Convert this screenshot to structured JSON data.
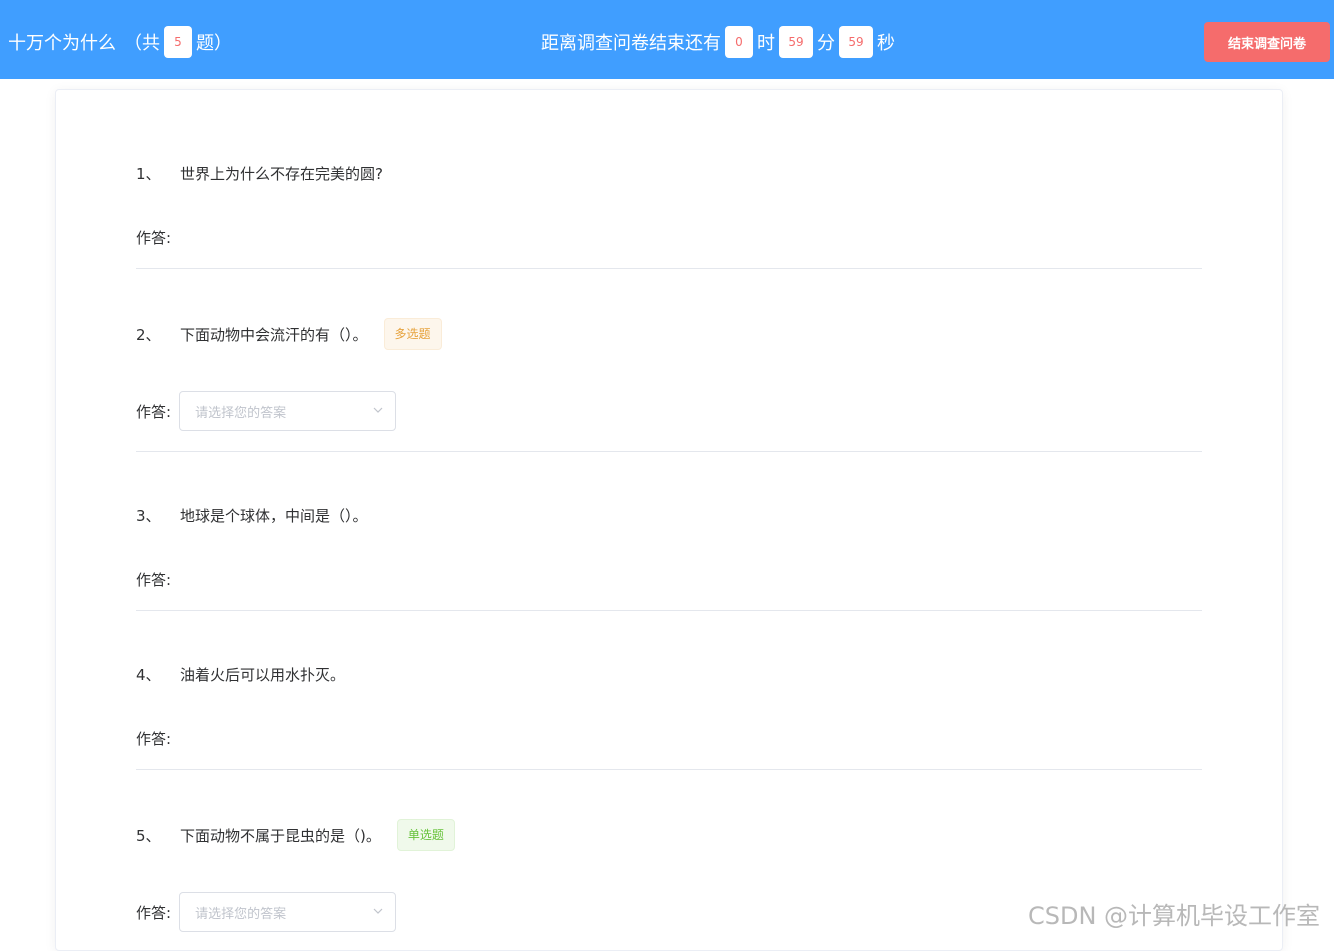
{
  "header": {
    "survey_title": "十万个为什么",
    "count_prefix": "（共",
    "question_count": "5",
    "count_suffix": "题）",
    "timer_label": "距离调查问卷结束还有",
    "hours": "0",
    "hours_unit": "时",
    "minutes": "59",
    "minutes_unit": "分",
    "seconds": "59",
    "seconds_unit": "秒",
    "end_button": "结束调查问卷"
  },
  "answer_label": "作答:",
  "select_placeholder": "请选择您的答案",
  "questions": [
    {
      "num": "1、",
      "text": "世界上为什么不存在完美的圆?",
      "tag": ""
    },
    {
      "num": "2、",
      "text": "下面动物中会流汗的有（）。",
      "tag": "多选题"
    },
    {
      "num": "3、",
      "text": "地球是个球体，中间是（）。",
      "tag": ""
    },
    {
      "num": "4、",
      "text": "油着火后可以用水扑灭。",
      "tag": ""
    },
    {
      "num": "5、",
      "text": "下面动物不属于昆虫的是（)。",
      "tag": "单选题"
    }
  ],
  "watermark": "CSDN @计算机毕设工作室",
  "colors": {
    "header_bg": "#409eff",
    "end_button_bg": "#f56c6c",
    "timer_digits": "#f56c6c",
    "tag_multi": "#e6a23c",
    "tag_single": "#67c23a"
  }
}
